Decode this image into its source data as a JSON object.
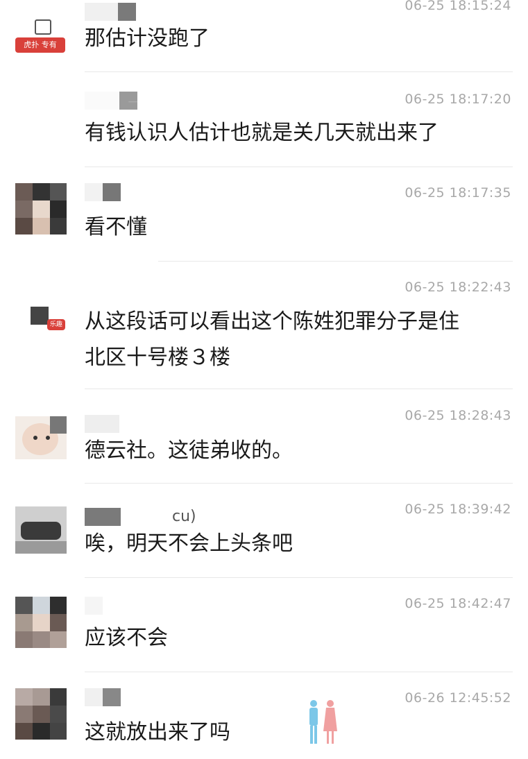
{
  "comments": [
    {
      "time": "06-25 18:15:24",
      "text": "那估计没跑了",
      "badge": "虎扑 专有"
    },
    {
      "time": "06-25 18:17:20",
      "text": "有钱认识人估计也就是关几天就出来了"
    },
    {
      "time": "06-25 18:17:35",
      "text": "看不懂"
    },
    {
      "time": "06-25 18:22:43",
      "text_line1": "从这段话可以看出这个陈姓犯罪分子是住",
      "text_line2": "北区十号楼３楼",
      "badge": "乐趣"
    },
    {
      "time": "06-25 18:28:43",
      "text": "德云社。这徒弟收的。"
    },
    {
      "time": "06-25 18:39:42",
      "text": "唉，明天不会上头条吧",
      "user_suffix": "cu)"
    },
    {
      "time": "06-25 18:42:47",
      "text": "应该不会"
    },
    {
      "time": "06-26 12:45:52",
      "text": "这就放出来了吗"
    }
  ],
  "colors": {
    "text": "#1a1a1a",
    "time": "#a8a8a8",
    "divider": "#e8e8e8",
    "badge": "#d9403a"
  }
}
